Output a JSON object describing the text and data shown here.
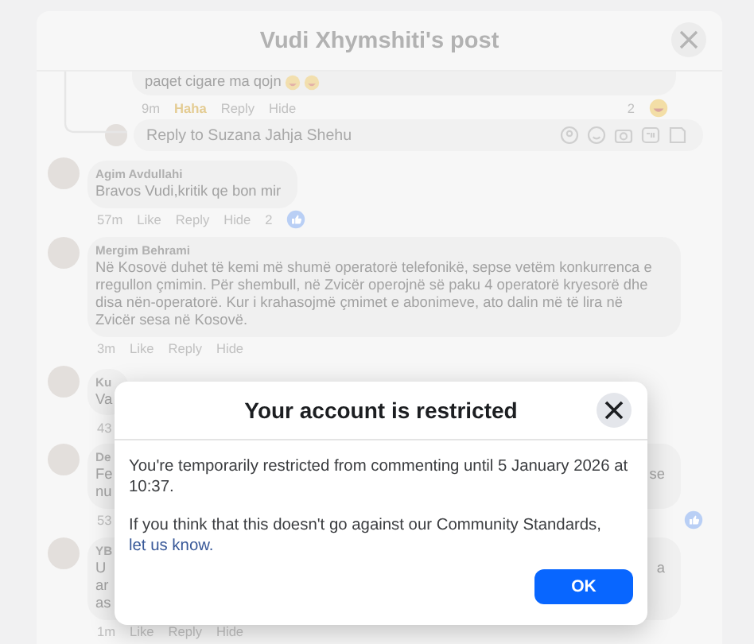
{
  "post_dialog": {
    "title": "Vudi Xhymshiti's post"
  },
  "reply": {
    "text": "paqet cigare ma qojn",
    "time": "9m",
    "reaction_label": "Haha",
    "actions": [
      "Reply",
      "Hide"
    ],
    "reaction_count": "2"
  },
  "reply_field": {
    "placeholder": "Reply to Suzana Jahja Shehu"
  },
  "comments": [
    {
      "author": "Agim Avdullahi",
      "lines": [
        "Bravos Vudi,kritik qe bon mir"
      ],
      "time": "57m",
      "actions": [
        "Like",
        "Reply",
        "Hide"
      ],
      "reaction_count": "2",
      "liked": true
    },
    {
      "author": "Mergim Behrami",
      "lines": [
        "Në Kosovë duhet të kemi më shumë operatorë telefonikë, sepse vetëm konkurrenca e rregullon çmimin. Për shembull, në Zvicër operojnë së paku 4 operatorë kryesorë dhe disa nën-operatorë. Kur i krahasojmë çmimet e abonimeve, ato dalin më të lira në Zvicër sesa në Kosovë."
      ],
      "time": "3m",
      "actions": [
        "Like",
        "Reply",
        "Hide"
      ],
      "liked": false
    },
    {
      "author": "Ku",
      "lines": [
        "Va"
      ],
      "time": "43",
      "liked": false
    },
    {
      "author": "De",
      "lines": [
        "Fe",
        "nu"
      ],
      "line_end": "se",
      "time": "53",
      "liked": true
    },
    {
      "author": "YB",
      "lines": [
        "U",
        "ar",
        "as"
      ],
      "line_end": "a",
      "time": "1m",
      "actions": [
        "Like",
        "Reply",
        "Hide"
      ],
      "liked": false
    }
  ],
  "restriction_dialog": {
    "title": "Your account is restricted",
    "message": "You're temporarily restricted from commenting until 5 January 2026 at 10:37.",
    "note": "If you think that this doesn't go against our Community Standards,",
    "link": "let us know.",
    "button": "OK"
  }
}
